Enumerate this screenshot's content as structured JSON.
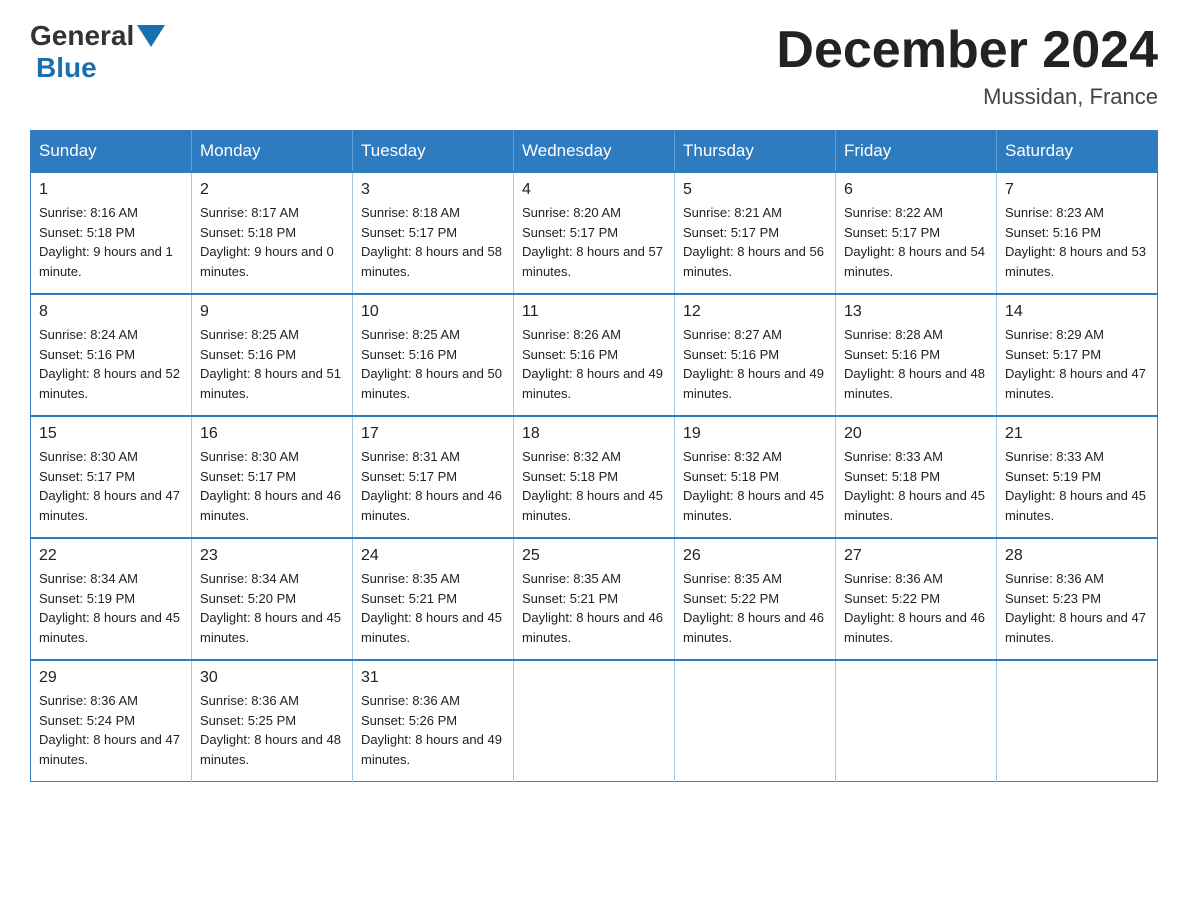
{
  "header": {
    "logo": {
      "general": "General",
      "blue": "Blue"
    },
    "title": "December 2024",
    "location": "Mussidan, France"
  },
  "days_of_week": [
    "Sunday",
    "Monday",
    "Tuesday",
    "Wednesday",
    "Thursday",
    "Friday",
    "Saturday"
  ],
  "weeks": [
    [
      {
        "day": "1",
        "sunrise": "8:16 AM",
        "sunset": "5:18 PM",
        "daylight": "9 hours and 1 minute."
      },
      {
        "day": "2",
        "sunrise": "8:17 AM",
        "sunset": "5:18 PM",
        "daylight": "9 hours and 0 minutes."
      },
      {
        "day": "3",
        "sunrise": "8:18 AM",
        "sunset": "5:17 PM",
        "daylight": "8 hours and 58 minutes."
      },
      {
        "day": "4",
        "sunrise": "8:20 AM",
        "sunset": "5:17 PM",
        "daylight": "8 hours and 57 minutes."
      },
      {
        "day": "5",
        "sunrise": "8:21 AM",
        "sunset": "5:17 PM",
        "daylight": "8 hours and 56 minutes."
      },
      {
        "day": "6",
        "sunrise": "8:22 AM",
        "sunset": "5:17 PM",
        "daylight": "8 hours and 54 minutes."
      },
      {
        "day": "7",
        "sunrise": "8:23 AM",
        "sunset": "5:16 PM",
        "daylight": "8 hours and 53 minutes."
      }
    ],
    [
      {
        "day": "8",
        "sunrise": "8:24 AM",
        "sunset": "5:16 PM",
        "daylight": "8 hours and 52 minutes."
      },
      {
        "day": "9",
        "sunrise": "8:25 AM",
        "sunset": "5:16 PM",
        "daylight": "8 hours and 51 minutes."
      },
      {
        "day": "10",
        "sunrise": "8:25 AM",
        "sunset": "5:16 PM",
        "daylight": "8 hours and 50 minutes."
      },
      {
        "day": "11",
        "sunrise": "8:26 AM",
        "sunset": "5:16 PM",
        "daylight": "8 hours and 49 minutes."
      },
      {
        "day": "12",
        "sunrise": "8:27 AM",
        "sunset": "5:16 PM",
        "daylight": "8 hours and 49 minutes."
      },
      {
        "day": "13",
        "sunrise": "8:28 AM",
        "sunset": "5:16 PM",
        "daylight": "8 hours and 48 minutes."
      },
      {
        "day": "14",
        "sunrise": "8:29 AM",
        "sunset": "5:17 PM",
        "daylight": "8 hours and 47 minutes."
      }
    ],
    [
      {
        "day": "15",
        "sunrise": "8:30 AM",
        "sunset": "5:17 PM",
        "daylight": "8 hours and 47 minutes."
      },
      {
        "day": "16",
        "sunrise": "8:30 AM",
        "sunset": "5:17 PM",
        "daylight": "8 hours and 46 minutes."
      },
      {
        "day": "17",
        "sunrise": "8:31 AM",
        "sunset": "5:17 PM",
        "daylight": "8 hours and 46 minutes."
      },
      {
        "day": "18",
        "sunrise": "8:32 AM",
        "sunset": "5:18 PM",
        "daylight": "8 hours and 45 minutes."
      },
      {
        "day": "19",
        "sunrise": "8:32 AM",
        "sunset": "5:18 PM",
        "daylight": "8 hours and 45 minutes."
      },
      {
        "day": "20",
        "sunrise": "8:33 AM",
        "sunset": "5:18 PM",
        "daylight": "8 hours and 45 minutes."
      },
      {
        "day": "21",
        "sunrise": "8:33 AM",
        "sunset": "5:19 PM",
        "daylight": "8 hours and 45 minutes."
      }
    ],
    [
      {
        "day": "22",
        "sunrise": "8:34 AM",
        "sunset": "5:19 PM",
        "daylight": "8 hours and 45 minutes."
      },
      {
        "day": "23",
        "sunrise": "8:34 AM",
        "sunset": "5:20 PM",
        "daylight": "8 hours and 45 minutes."
      },
      {
        "day": "24",
        "sunrise": "8:35 AM",
        "sunset": "5:21 PM",
        "daylight": "8 hours and 45 minutes."
      },
      {
        "day": "25",
        "sunrise": "8:35 AM",
        "sunset": "5:21 PM",
        "daylight": "8 hours and 46 minutes."
      },
      {
        "day": "26",
        "sunrise": "8:35 AM",
        "sunset": "5:22 PM",
        "daylight": "8 hours and 46 minutes."
      },
      {
        "day": "27",
        "sunrise": "8:36 AM",
        "sunset": "5:22 PM",
        "daylight": "8 hours and 46 minutes."
      },
      {
        "day": "28",
        "sunrise": "8:36 AM",
        "sunset": "5:23 PM",
        "daylight": "8 hours and 47 minutes."
      }
    ],
    [
      {
        "day": "29",
        "sunrise": "8:36 AM",
        "sunset": "5:24 PM",
        "daylight": "8 hours and 47 minutes."
      },
      {
        "day": "30",
        "sunrise": "8:36 AM",
        "sunset": "5:25 PM",
        "daylight": "8 hours and 48 minutes."
      },
      {
        "day": "31",
        "sunrise": "8:36 AM",
        "sunset": "5:26 PM",
        "daylight": "8 hours and 49 minutes."
      },
      null,
      null,
      null,
      null
    ]
  ],
  "labels": {
    "sunrise": "Sunrise:",
    "sunset": "Sunset:",
    "daylight": "Daylight:"
  }
}
